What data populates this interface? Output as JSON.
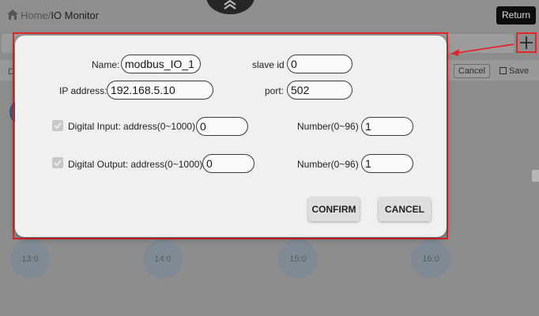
{
  "header": {
    "breadcrumb_home": "Home",
    "breadcrumb_sep": "/",
    "breadcrumb_current": "IO Monitor",
    "return_label": "Return"
  },
  "background": {
    "row_label": "D",
    "cancel_label": "Cancel",
    "save_label": "Save",
    "io_points": [
      "13:0",
      "14:0",
      "15:0",
      "16:0"
    ]
  },
  "dialog": {
    "name_label": "Name:",
    "name_value": "modbus_IO_1",
    "slave_id_label": "slave id",
    "slave_id_value": "0",
    "ip_label": "IP address:",
    "ip_value": "192.168.5.10",
    "port_label": "port:",
    "port_value": "502",
    "di_label": "Digital Input: address(0~1000)",
    "di_address_value": "0",
    "di_number_label": "Number(0~96)",
    "di_number_value": "1",
    "do_label": "Digital Output: address(0~1000)",
    "do_address_value": "0",
    "do_number_label": "Number(0~96)",
    "do_number_value": "1",
    "confirm_label": "CONFIRM",
    "cancel_label": "CANCEL"
  },
  "colors": {
    "annotation": "#e3242b",
    "dialog_bg": "#f0f0f0",
    "overlay": "#8d8d8d"
  }
}
